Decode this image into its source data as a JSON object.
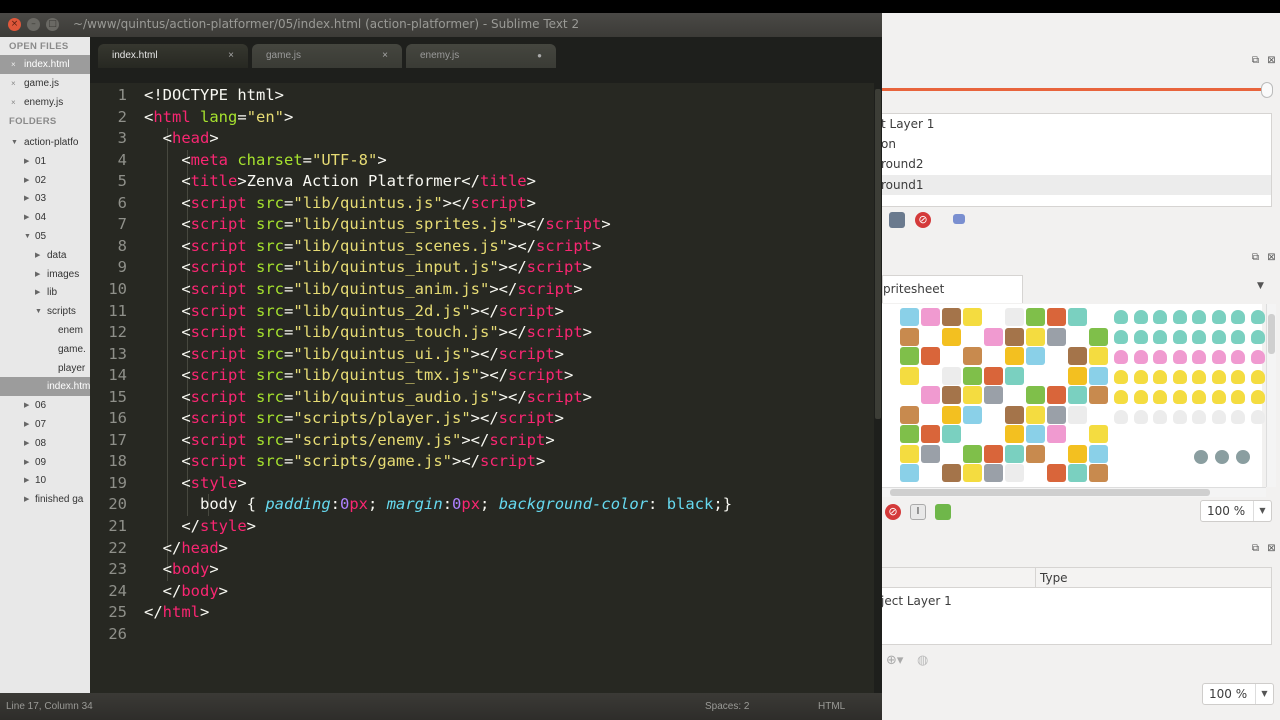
{
  "sublime": {
    "window_title": "~/www/quintus/action-platformer/05/index.html (action-platformer) - Sublime Text 2",
    "sidebar": {
      "open_files_header": "OPEN FILES",
      "open_files": [
        {
          "label": "index.html",
          "selected": true
        },
        {
          "label": "game.js",
          "selected": false
        },
        {
          "label": "enemy.js",
          "selected": false
        }
      ],
      "folders_header": "FOLDERS",
      "tree": [
        {
          "label": "action-platfo",
          "indent": 1,
          "arrow": "▼"
        },
        {
          "label": "01",
          "indent": 2,
          "arrow": "▶"
        },
        {
          "label": "02",
          "indent": 2,
          "arrow": "▶"
        },
        {
          "label": "03",
          "indent": 2,
          "arrow": "▶"
        },
        {
          "label": "04",
          "indent": 2,
          "arrow": "▶"
        },
        {
          "label": "05",
          "indent": 2,
          "arrow": "▼"
        },
        {
          "label": "data",
          "indent": 3,
          "arrow": "▶"
        },
        {
          "label": "images",
          "indent": 3,
          "arrow": "▶"
        },
        {
          "label": "lib",
          "indent": 3,
          "arrow": "▶"
        },
        {
          "label": "scripts",
          "indent": 3,
          "arrow": "▼"
        },
        {
          "label": "enem",
          "indent": 4,
          "arrow": ""
        },
        {
          "label": "game.",
          "indent": 4,
          "arrow": ""
        },
        {
          "label": "player",
          "indent": 4,
          "arrow": ""
        },
        {
          "label": "index.htm",
          "indent": 3,
          "arrow": "",
          "selected": true
        },
        {
          "label": "06",
          "indent": 2,
          "arrow": "▶"
        },
        {
          "label": "07",
          "indent": 2,
          "arrow": "▶"
        },
        {
          "label": "08",
          "indent": 2,
          "arrow": "▶"
        },
        {
          "label": "09",
          "indent": 2,
          "arrow": "▶"
        },
        {
          "label": "10",
          "indent": 2,
          "arrow": "▶"
        },
        {
          "label": "finished ga",
          "indent": 2,
          "arrow": "▶"
        }
      ]
    },
    "tabs": [
      {
        "label": "index.html",
        "active": true,
        "close": "×"
      },
      {
        "label": "game.js",
        "active": false,
        "close": "×"
      },
      {
        "label": "enemy.js",
        "active": false,
        "close": "●"
      }
    ],
    "line_numbers": [
      "1",
      "2",
      "3",
      "4",
      "5",
      "6",
      "7",
      "8",
      "9",
      "10",
      "11",
      "12",
      "13",
      "14",
      "15",
      "16",
      "17",
      "18",
      "19",
      "20",
      "21",
      "22",
      "23",
      "24",
      "25",
      "26"
    ],
    "status": {
      "position": "Line 17, Column 34",
      "spaces": "Spaces: 2",
      "syntax": "HTML"
    },
    "code_lines": [
      [
        [
          "t-punct",
          "<!DOCTYPE html>"
        ]
      ],
      [
        [
          "t-punct",
          "<"
        ],
        [
          "t-tag",
          "html"
        ],
        [
          "t-punct",
          " "
        ],
        [
          "t-attr",
          "lang"
        ],
        [
          "t-punct",
          "="
        ],
        [
          "t-str",
          "\"en\""
        ],
        [
          "t-punct",
          ">"
        ]
      ],
      [
        [
          "t-punct",
          "  <"
        ],
        [
          "t-tag",
          "head"
        ],
        [
          "t-punct",
          ">"
        ]
      ],
      [
        [
          "t-punct",
          "    <"
        ],
        [
          "t-tag",
          "meta"
        ],
        [
          "t-punct",
          " "
        ],
        [
          "t-attr",
          "charset"
        ],
        [
          "t-punct",
          "="
        ],
        [
          "t-str",
          "\"UTF-8\""
        ],
        [
          "t-punct",
          ">"
        ]
      ],
      [
        [
          "t-punct",
          "    <"
        ],
        [
          "t-tag",
          "title"
        ],
        [
          "t-punct",
          ">Zenva Action Platformer</"
        ],
        [
          "t-tag",
          "title"
        ],
        [
          "t-punct",
          ">"
        ]
      ],
      [
        [
          "t-punct",
          "    <"
        ],
        [
          "t-tag",
          "script"
        ],
        [
          "t-punct",
          " "
        ],
        [
          "t-attr",
          "src"
        ],
        [
          "t-punct",
          "="
        ],
        [
          "t-str",
          "\"lib/quintus.js\""
        ],
        [
          "t-punct",
          "></"
        ],
        [
          "t-tag",
          "script"
        ],
        [
          "t-punct",
          ">"
        ]
      ],
      [
        [
          "t-punct",
          "    <"
        ],
        [
          "t-tag",
          "script"
        ],
        [
          "t-punct",
          " "
        ],
        [
          "t-attr",
          "src"
        ],
        [
          "t-punct",
          "="
        ],
        [
          "t-str",
          "\"lib/quintus_sprites.js\""
        ],
        [
          "t-punct",
          "></"
        ],
        [
          "t-tag",
          "script"
        ],
        [
          "t-punct",
          ">"
        ]
      ],
      [
        [
          "t-punct",
          "    <"
        ],
        [
          "t-tag",
          "script"
        ],
        [
          "t-punct",
          " "
        ],
        [
          "t-attr",
          "src"
        ],
        [
          "t-punct",
          "="
        ],
        [
          "t-str",
          "\"lib/quintus_scenes.js\""
        ],
        [
          "t-punct",
          "></"
        ],
        [
          "t-tag",
          "script"
        ],
        [
          "t-punct",
          ">"
        ]
      ],
      [
        [
          "t-punct",
          "    <"
        ],
        [
          "t-tag",
          "script"
        ],
        [
          "t-punct",
          " "
        ],
        [
          "t-attr",
          "src"
        ],
        [
          "t-punct",
          "="
        ],
        [
          "t-str",
          "\"lib/quintus_input.js\""
        ],
        [
          "t-punct",
          "></"
        ],
        [
          "t-tag",
          "script"
        ],
        [
          "t-punct",
          ">"
        ]
      ],
      [
        [
          "t-punct",
          "    <"
        ],
        [
          "t-tag",
          "script"
        ],
        [
          "t-punct",
          " "
        ],
        [
          "t-attr",
          "src"
        ],
        [
          "t-punct",
          "="
        ],
        [
          "t-str",
          "\"lib/quintus_anim.js\""
        ],
        [
          "t-punct",
          "></"
        ],
        [
          "t-tag",
          "script"
        ],
        [
          "t-punct",
          ">"
        ]
      ],
      [
        [
          "t-punct",
          "    <"
        ],
        [
          "t-tag",
          "script"
        ],
        [
          "t-punct",
          " "
        ],
        [
          "t-attr",
          "src"
        ],
        [
          "t-punct",
          "="
        ],
        [
          "t-str",
          "\"lib/quintus_2d.js\""
        ],
        [
          "t-punct",
          "></"
        ],
        [
          "t-tag",
          "script"
        ],
        [
          "t-punct",
          ">"
        ]
      ],
      [
        [
          "t-punct",
          "    <"
        ],
        [
          "t-tag",
          "script"
        ],
        [
          "t-punct",
          " "
        ],
        [
          "t-attr",
          "src"
        ],
        [
          "t-punct",
          "="
        ],
        [
          "t-str",
          "\"lib/quintus_touch.js\""
        ],
        [
          "t-punct",
          "></"
        ],
        [
          "t-tag",
          "script"
        ],
        [
          "t-punct",
          ">"
        ]
      ],
      [
        [
          "t-punct",
          "    <"
        ],
        [
          "t-tag",
          "script"
        ],
        [
          "t-punct",
          " "
        ],
        [
          "t-attr",
          "src"
        ],
        [
          "t-punct",
          "="
        ],
        [
          "t-str",
          "\"lib/quintus_ui.js\""
        ],
        [
          "t-punct",
          "></"
        ],
        [
          "t-tag",
          "script"
        ],
        [
          "t-punct",
          ">"
        ]
      ],
      [
        [
          "t-punct",
          "    <"
        ],
        [
          "t-tag",
          "script"
        ],
        [
          "t-punct",
          " "
        ],
        [
          "t-attr",
          "src"
        ],
        [
          "t-punct",
          "="
        ],
        [
          "t-str",
          "\"lib/quintus_tmx.js\""
        ],
        [
          "t-punct",
          "></"
        ],
        [
          "t-tag",
          "script"
        ],
        [
          "t-punct",
          ">"
        ]
      ],
      [
        [
          "t-punct",
          "    <"
        ],
        [
          "t-tag",
          "script"
        ],
        [
          "t-punct",
          " "
        ],
        [
          "t-attr",
          "src"
        ],
        [
          "t-punct",
          "="
        ],
        [
          "t-str",
          "\"lib/quintus_audio.js\""
        ],
        [
          "t-punct",
          "></"
        ],
        [
          "t-tag",
          "script"
        ],
        [
          "t-punct",
          ">"
        ]
      ],
      [
        [
          "t-punct",
          "    <"
        ],
        [
          "t-tag",
          "script"
        ],
        [
          "t-punct",
          " "
        ],
        [
          "t-attr",
          "src"
        ],
        [
          "t-punct",
          "="
        ],
        [
          "t-str",
          "\"scripts/player.js\""
        ],
        [
          "t-punct",
          "></"
        ],
        [
          "t-tag",
          "script"
        ],
        [
          "t-punct",
          ">"
        ]
      ],
      [
        [
          "t-punct",
          "    <"
        ],
        [
          "t-tag",
          "script"
        ],
        [
          "t-punct",
          " "
        ],
        [
          "t-attr",
          "src"
        ],
        [
          "t-punct",
          "="
        ],
        [
          "t-str",
          "\"scripts/enemy.js\""
        ],
        [
          "t-punct",
          "></"
        ],
        [
          "t-tag",
          "script"
        ],
        [
          "t-punct",
          ">"
        ]
      ],
      [
        [
          "t-punct",
          "    <"
        ],
        [
          "t-tag",
          "script"
        ],
        [
          "t-punct",
          " "
        ],
        [
          "t-attr",
          "src"
        ],
        [
          "t-punct",
          "="
        ],
        [
          "t-str",
          "\"scripts/game.js\""
        ],
        [
          "t-punct",
          "></"
        ],
        [
          "t-tag",
          "script"
        ],
        [
          "t-punct",
          ">"
        ]
      ],
      [
        [
          "t-punct",
          "    <"
        ],
        [
          "t-tag",
          "style"
        ],
        [
          "t-punct",
          ">"
        ]
      ],
      [
        [
          "t-punct",
          "      body { "
        ],
        [
          "t-prop",
          "padding"
        ],
        [
          "t-punct",
          ":"
        ],
        [
          "t-num",
          "0"
        ],
        [
          "t-unit",
          "px"
        ],
        [
          "t-punct",
          "; "
        ],
        [
          "t-prop",
          "margin"
        ],
        [
          "t-punct",
          ":"
        ],
        [
          "t-num",
          "0"
        ],
        [
          "t-unit",
          "px"
        ],
        [
          "t-punct",
          "; "
        ],
        [
          "t-prop",
          "background-color"
        ],
        [
          "t-punct",
          ": "
        ],
        [
          "t-val",
          "black"
        ],
        [
          "t-punct",
          ";}"
        ]
      ],
      [
        [
          "t-punct",
          "    </"
        ],
        [
          "t-tag",
          "style"
        ],
        [
          "t-punct",
          ">"
        ]
      ],
      [
        [
          "t-punct",
          "  </"
        ],
        [
          "t-tag",
          "head"
        ],
        [
          "t-punct",
          ">"
        ]
      ],
      [
        [
          "t-punct",
          "  <"
        ],
        [
          "t-tag",
          "body"
        ],
        [
          "t-punct",
          ">"
        ]
      ],
      [
        [
          "t-punct",
          "  </"
        ],
        [
          "t-tag",
          "body"
        ],
        [
          "t-punct",
          ">"
        ]
      ],
      [
        [
          "t-punct",
          "</"
        ],
        [
          "t-tag",
          "html"
        ],
        [
          "t-punct",
          ">"
        ]
      ],
      []
    ]
  },
  "tiled": {
    "layers": [
      {
        "label": "t Layer 1",
        "selected": false
      },
      {
        "label": "on",
        "selected": false
      },
      {
        "label": "round2",
        "selected": false
      },
      {
        "label": "round1",
        "selected": true
      }
    ],
    "tileset_tab": "pritesheet",
    "tileset_zoom": "100 %",
    "objects_column_header": "Type",
    "objects_row": "ject Layer 1",
    "objects_zoom": "100 %",
    "slider_color": "#e8643c"
  }
}
